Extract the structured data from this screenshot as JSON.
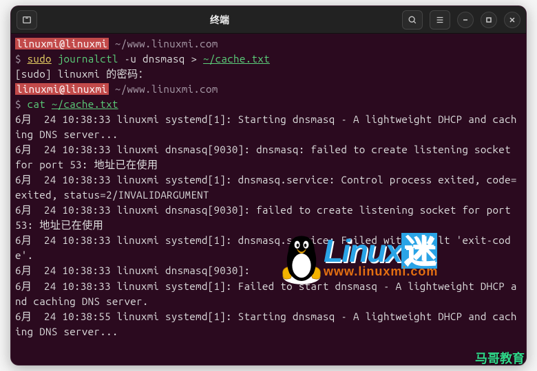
{
  "titlebar": {
    "title": "终端"
  },
  "prompt": {
    "userhost": "linuxmi@linuxmi",
    "path": "~/www.linuxmi.com",
    "symbol": "$"
  },
  "cmd1": {
    "sudo": "sudo",
    "journalctl": "journalctl",
    "args": " -u dnsmasq > ",
    "outfile": "~/cache.txt"
  },
  "sudo_prompt": "[sudo] linuxmi 的密码：",
  "cmd2": {
    "cat": "cat",
    "file": "~/cache.txt"
  },
  "log": [
    "6月  24 10:38:33 linuxmi systemd[1]: Starting dnsmasq - A lightweight DHCP and caching DNS server...",
    "6月  24 10:38:33 linuxmi dnsmasq[9030]: dnsmasq: failed to create listening socket for port 53: 地址已在使用",
    "6月  24 10:38:33 linuxmi systemd[1]: dnsmasq.service: Control process exited, code=exited, status=2/INVALIDARGUMENT",
    "6月  24 10:38:33 linuxmi dnsmasq[9030]: failed to create listening socket for port 53: 地址已在使用",
    "6月  24 10:38:33 linuxmi systemd[1]: dnsmasq.service: Failed with result 'exit-code'.",
    "6月  24 10:38:33 linuxmi dnsmasq[9030]:",
    "6月  24 10:38:33 linuxmi systemd[1]: Failed to start dnsmasq - A lightweight DHCP and caching DNS server.",
    "6月  24 10:38:55 linuxmi systemd[1]: Starting dnsmasq - A lightweight DHCP and caching DNS server..."
  ],
  "logo": {
    "linux": "Linux",
    "mi": "迷",
    "url": "www.linuxmi.com"
  },
  "watermark": "马哥教育"
}
